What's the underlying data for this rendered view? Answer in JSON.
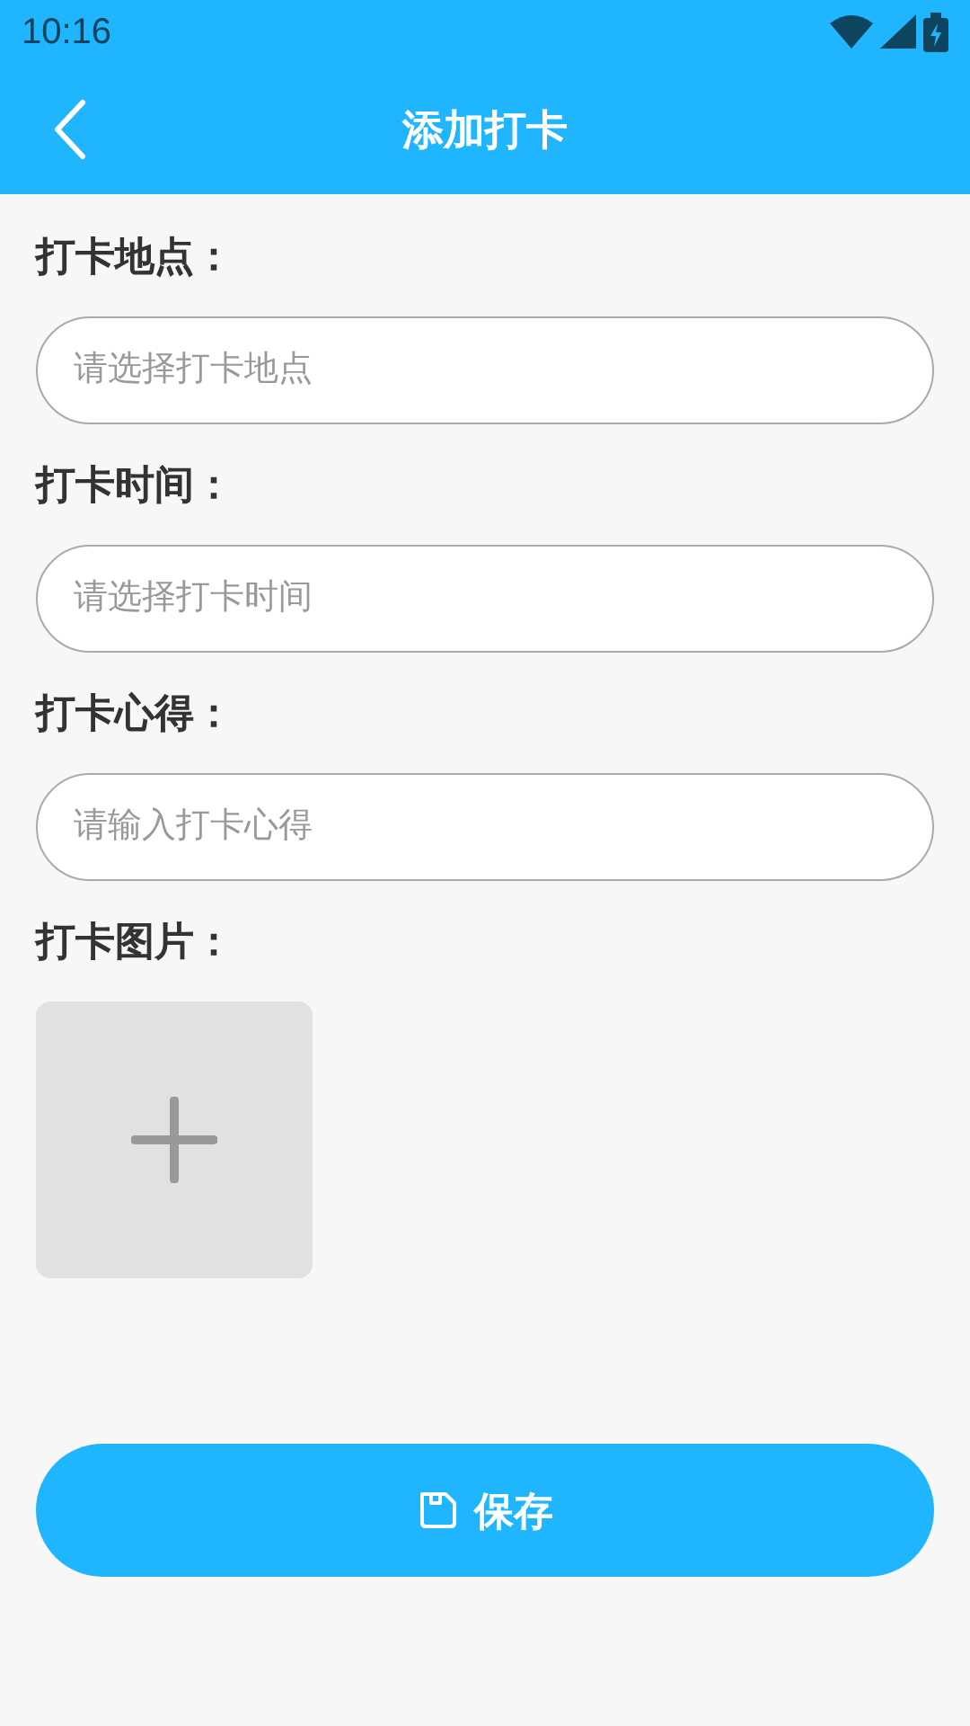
{
  "status_bar": {
    "time": "10:16"
  },
  "header": {
    "title": "添加打卡"
  },
  "form": [
    {
      "kind": "field",
      "label": "打卡地点：",
      "placeholder": "请选择打卡地点"
    },
    {
      "kind": "field",
      "label": "打卡时间：",
      "placeholder": "请选择打卡时间"
    },
    {
      "kind": "field",
      "label": "打卡心得：",
      "placeholder": "请输入打卡心得"
    },
    {
      "kind": "upload",
      "label": "打卡图片："
    }
  ],
  "save_button": {
    "label": "保存"
  }
}
